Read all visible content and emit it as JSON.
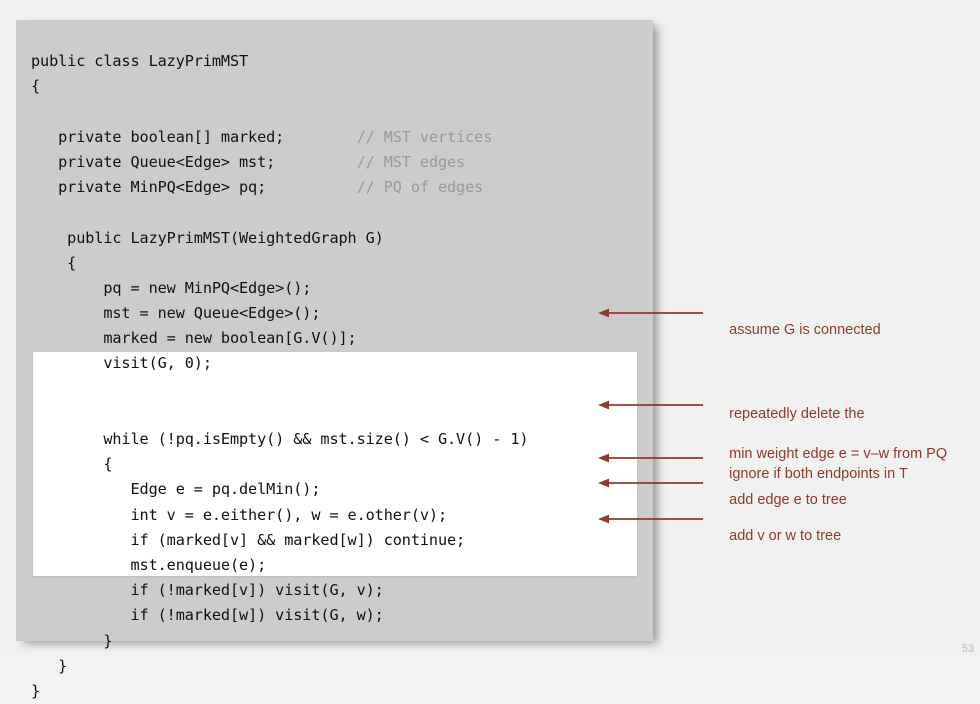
{
  "slide": {
    "page_number": "53",
    "panel_bg_color": "#cccccc",
    "highlight_bg_color": "#ffffff",
    "annotation_color": "#8e3b2c",
    "comment_color": "#9a9a9a",
    "code_color": "#111111"
  },
  "code": {
    "language": "java",
    "lines": [
      {
        "text": "public class LazyPrimMST",
        "comment": ""
      },
      {
        "text": "{",
        "comment": ""
      },
      {
        "text": "",
        "comment": ""
      },
      {
        "text": "   private boolean[] marked;",
        "comment": "// MST vertices"
      },
      {
        "text": "   private Queue<Edge> mst;",
        "comment": "// MST edges"
      },
      {
        "text": "   private MinPQ<Edge> pq;",
        "comment": "// PQ of edges"
      },
      {
        "text": "",
        "comment": ""
      },
      {
        "text": "    public LazyPrimMST(WeightedGraph G)",
        "comment": ""
      },
      {
        "text": "    {",
        "comment": ""
      },
      {
        "text": "        pq = new MinPQ<Edge>();",
        "comment": ""
      },
      {
        "text": "        mst = new Queue<Edge>();",
        "comment": ""
      },
      {
        "text": "        marked = new boolean[G.V()];",
        "comment": ""
      },
      {
        "text": "        visit(G, 0);",
        "comment": ""
      },
      {
        "text": "",
        "comment": ""
      },
      {
        "text": "",
        "comment": ""
      },
      {
        "text": "        while (!pq.isEmpty() && mst.size() < G.V() - 1)",
        "comment": ""
      },
      {
        "text": "        {",
        "comment": ""
      },
      {
        "text": "           Edge e = pq.delMin();",
        "comment": ""
      },
      {
        "text": "           int v = e.either(), w = e.other(v);",
        "comment": ""
      },
      {
        "text": "           if (marked[v] && marked[w]) continue;",
        "comment": ""
      },
      {
        "text": "           mst.enqueue(e);",
        "comment": ""
      },
      {
        "text": "           if (!marked[v]) visit(G, v);",
        "comment": ""
      },
      {
        "text": "           if (!marked[w]) visit(G, w);",
        "comment": ""
      },
      {
        "text": "        }",
        "comment": ""
      },
      {
        "text": "   }",
        "comment": ""
      },
      {
        "text": "}",
        "comment": ""
      }
    ]
  },
  "annotations": [
    {
      "id": "assume-connected",
      "lines": [
        "assume G is connected"
      ]
    },
    {
      "id": "repeatedly-delete-min",
      "lines": [
        "repeatedly delete the",
        "min weight edge e = v–w from PQ"
      ]
    },
    {
      "id": "ignore-both-endpoints",
      "lines": [
        "ignore if both endpoints in T"
      ]
    },
    {
      "id": "add-edge-to-tree",
      "lines": [
        "add edge e to tree"
      ]
    },
    {
      "id": "add-v-or-w-to-tree",
      "lines": [
        "add v or w to tree"
      ]
    }
  ]
}
